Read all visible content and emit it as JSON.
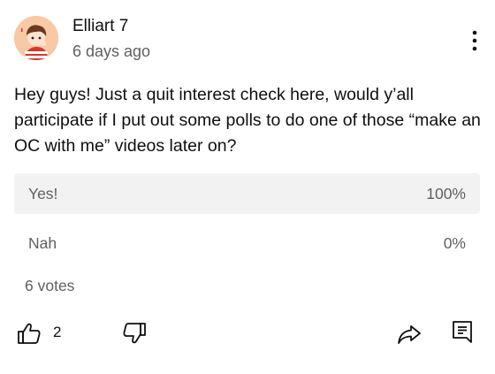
{
  "post": {
    "author": "Elliart 7",
    "timestamp": "6 days ago",
    "text": "Hey guys! Just a quit interest check here, would y’all participate if I put out some polls to do one of those “make an OC with me” videos later on?"
  },
  "poll": {
    "options": [
      {
        "label": "Yes!",
        "percent_text": "100%",
        "percent": 100
      },
      {
        "label": "Nah",
        "percent_text": "0%",
        "percent": 0
      }
    ],
    "votes_text": "6 votes"
  },
  "actions": {
    "like_count": "2",
    "icons": [
      "thumbs-up-icon",
      "thumbs-down-icon",
      "share-icon",
      "comment-icon",
      "more-vert-icon"
    ]
  },
  "colors": {
    "poll_fill": "#f2f2f2",
    "secondary_text": "#606060",
    "avatar_bg": "#f7c9a4"
  }
}
